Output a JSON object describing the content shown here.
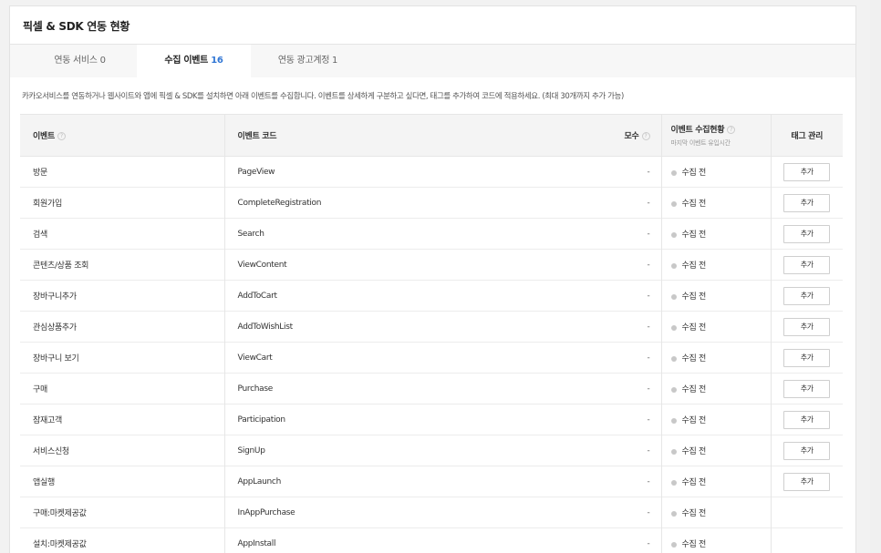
{
  "panel": {
    "title": "픽셀 & SDK 연동 현황",
    "description": "카카오서비스를 연동하거나 웹사이트와 앱에 픽셀 & SDK를 설치하면 아래 이벤트를 수집합니다. 이벤트를 상세하게 구분하고 싶다면, 태그를 추가하여 코드에 적용하세요. (최대 30개까지 추가 가능)"
  },
  "tabs": [
    {
      "label": "연동 서비스",
      "count": "0",
      "active": false
    },
    {
      "label": "수집 이벤트",
      "count": "16",
      "active": true
    },
    {
      "label": "연동 광고계정",
      "count": "1",
      "active": false
    }
  ],
  "table": {
    "headers": {
      "event": "이벤트",
      "code": "이벤트 코드",
      "count": "모수",
      "status": "이벤트 수집현황",
      "status_sub": "마지막 이벤트 유입시간",
      "tag": "태그 관리",
      "help_glyph": "?"
    },
    "rows": [
      {
        "event": "방문",
        "code": "PageView",
        "count": "-",
        "status": "수집 전",
        "tag_button": "추가"
      },
      {
        "event": "회원가입",
        "code": "CompleteRegistration",
        "count": "-",
        "status": "수집 전",
        "tag_button": "추가"
      },
      {
        "event": "검색",
        "code": "Search",
        "count": "-",
        "status": "수집 전",
        "tag_button": "추가"
      },
      {
        "event": "콘텐츠/상품 조회",
        "code": "ViewContent",
        "count": "-",
        "status": "수집 전",
        "tag_button": "추가"
      },
      {
        "event": "장바구니추가",
        "code": "AddToCart",
        "count": "-",
        "status": "수집 전",
        "tag_button": "추가"
      },
      {
        "event": "관심상품추가",
        "code": "AddToWishList",
        "count": "-",
        "status": "수집 전",
        "tag_button": "추가"
      },
      {
        "event": "장바구니 보기",
        "code": "ViewCart",
        "count": "-",
        "status": "수집 전",
        "tag_button": "추가"
      },
      {
        "event": "구매",
        "code": "Purchase",
        "count": "-",
        "status": "수집 전",
        "tag_button": "추가"
      },
      {
        "event": "잠재고객",
        "code": "Participation",
        "count": "-",
        "status": "수집 전",
        "tag_button": "추가"
      },
      {
        "event": "서비스신청",
        "code": "SignUp",
        "count": "-",
        "status": "수집 전",
        "tag_button": "추가"
      },
      {
        "event": "앱실행",
        "code": "AppLaunch",
        "count": "-",
        "status": "수집 전",
        "tag_button": "추가"
      },
      {
        "event": "구매:마켓제공값",
        "code": "InAppPurchase",
        "count": "-",
        "status": "수집 전",
        "tag_button": ""
      },
      {
        "event": "설치:마켓제공값",
        "code": "AppInstall",
        "count": "-",
        "status": "수집 전",
        "tag_button": ""
      }
    ]
  },
  "colors": {
    "accent": "#3277d5",
    "status_dot": "#c8c8c8"
  }
}
